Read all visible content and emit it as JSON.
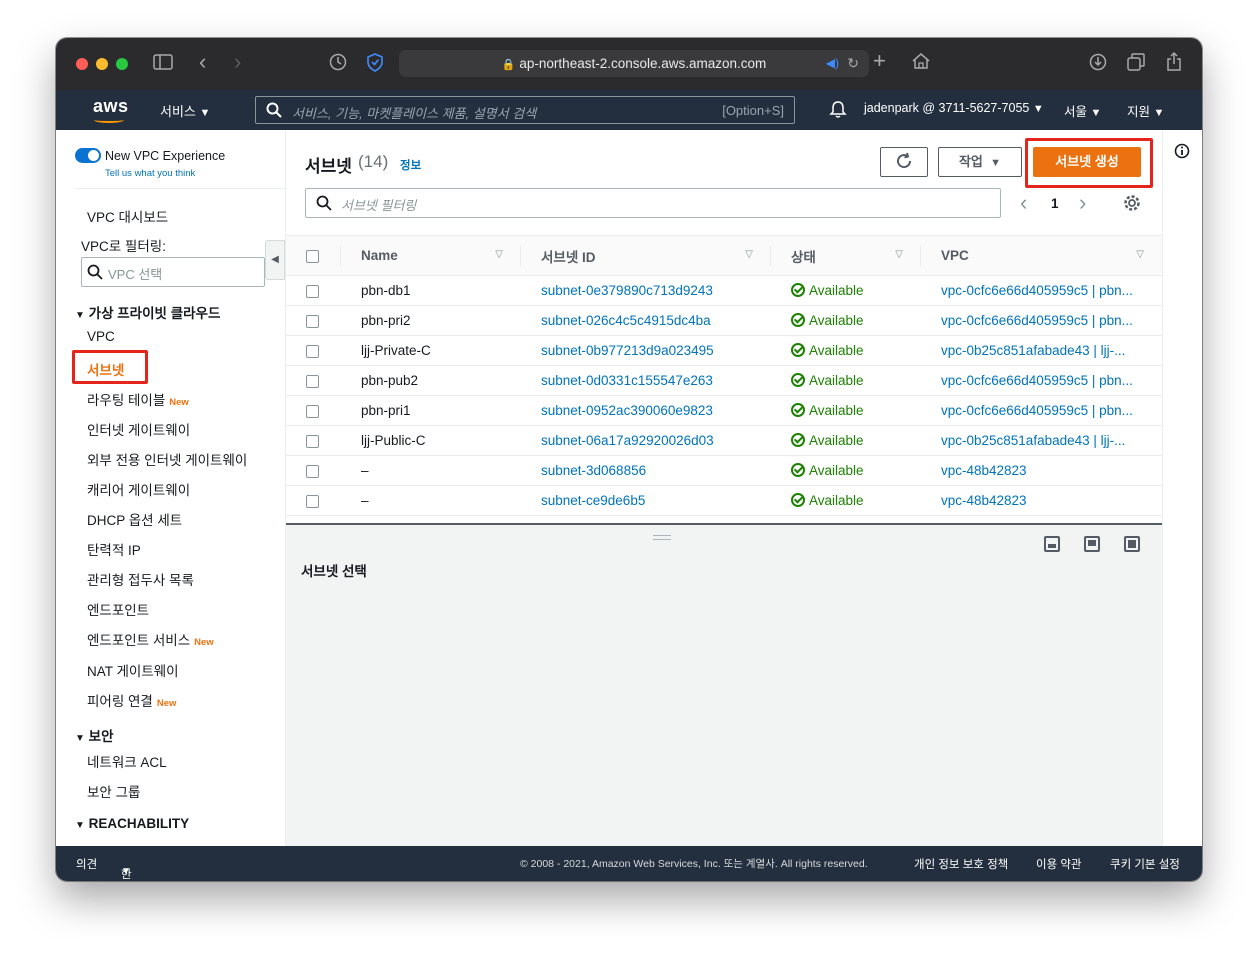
{
  "browser": {
    "url": "ap-northeast-2.console.aws.amazon.com"
  },
  "aws_nav": {
    "logo": "aws",
    "services": "서비스",
    "search_placeholder": "서비스, 기능, 마켓플레이스 제품, 설명서 검색",
    "search_shortcut": "[Option+S]",
    "account": "jadenpark @ 3711-5627-7055",
    "region": "서울",
    "support": "지원"
  },
  "sidebar": {
    "experience_label": "New VPC Experience",
    "experience_sub": "Tell us what you think",
    "dashboard": "VPC 대시보드",
    "filter_label": "VPC로 필터링:",
    "filter_placeholder": "VPC 선택",
    "section_vpc": "가상 프라이빗 클라우드",
    "items": [
      {
        "label": "VPC",
        "new": ""
      },
      {
        "label": "서브넷",
        "new": ""
      },
      {
        "label": "라우팅 테이블",
        "new": "New"
      },
      {
        "label": "인터넷 게이트웨이",
        "new": ""
      },
      {
        "label": "외부 전용 인터넷 게이트웨이",
        "new": ""
      },
      {
        "label": "캐리어 게이트웨이",
        "new": ""
      },
      {
        "label": "DHCP 옵션 세트",
        "new": ""
      },
      {
        "label": "탄력적 IP",
        "new": ""
      },
      {
        "label": "관리형 접두사 목록",
        "new": ""
      },
      {
        "label": "엔드포인트",
        "new": ""
      },
      {
        "label": "엔드포인트 서비스",
        "new": "New"
      },
      {
        "label": "NAT 게이트웨이",
        "new": ""
      },
      {
        "label": "피어링 연결",
        "new": "New"
      }
    ],
    "section_security": "보안",
    "security_items": [
      "네트워크 ACL",
      "보안 그룹"
    ],
    "section_reachability": "REACHABILITY"
  },
  "main": {
    "title": "서브넷",
    "count": "(14)",
    "info": "정보",
    "actions_label": "작업",
    "create_label": "서브넷 생성",
    "filter_placeholder": "서브넷 필터링",
    "page": "1",
    "columns": [
      "Name",
      "서브넷 ID",
      "상태",
      "VPC"
    ],
    "rows": [
      {
        "name": "pbn-db1",
        "id": "subnet-0e379890c713d9243",
        "state": "Available",
        "vpc": "vpc-0cfc6e66d405959c5 | pbn..."
      },
      {
        "name": "pbn-pri2",
        "id": "subnet-026c4c5c4915dc4ba",
        "state": "Available",
        "vpc": "vpc-0cfc6e66d405959c5 | pbn..."
      },
      {
        "name": "ljj-Private-C",
        "id": "subnet-0b977213d9a023495",
        "state": "Available",
        "vpc": "vpc-0b25c851afabade43 | ljj-..."
      },
      {
        "name": "pbn-pub2",
        "id": "subnet-0d0331c155547e263",
        "state": "Available",
        "vpc": "vpc-0cfc6e66d405959c5 | pbn..."
      },
      {
        "name": "pbn-pri1",
        "id": "subnet-0952ac390060e9823",
        "state": "Available",
        "vpc": "vpc-0cfc6e66d405959c5 | pbn..."
      },
      {
        "name": "ljj-Public-C",
        "id": "subnet-06a17a92920026d03",
        "state": "Available",
        "vpc": "vpc-0b25c851afabade43 | ljj-..."
      },
      {
        "name": "–",
        "id": "subnet-3d068856",
        "state": "Available",
        "vpc": "vpc-48b42823"
      },
      {
        "name": "–",
        "id": "subnet-ce9de6b5",
        "state": "Available",
        "vpc": "vpc-48b42823"
      }
    ],
    "detail_title": "서브넷 선택"
  },
  "footer": {
    "feedback": "의견",
    "language": "한국어",
    "copyright": "© 2008 - 2021, Amazon Web Services, Inc. 또는 계열사. All rights reserved.",
    "privacy": "개인 정보 보호 정책",
    "terms": "이용 약관",
    "cookies": "쿠키 기본 설정"
  },
  "colors": {
    "aws_nav": "#232f3e",
    "primary": "#ec7211",
    "link": "#0073bb",
    "success": "#1d8102",
    "highlight": "#e5241b"
  }
}
